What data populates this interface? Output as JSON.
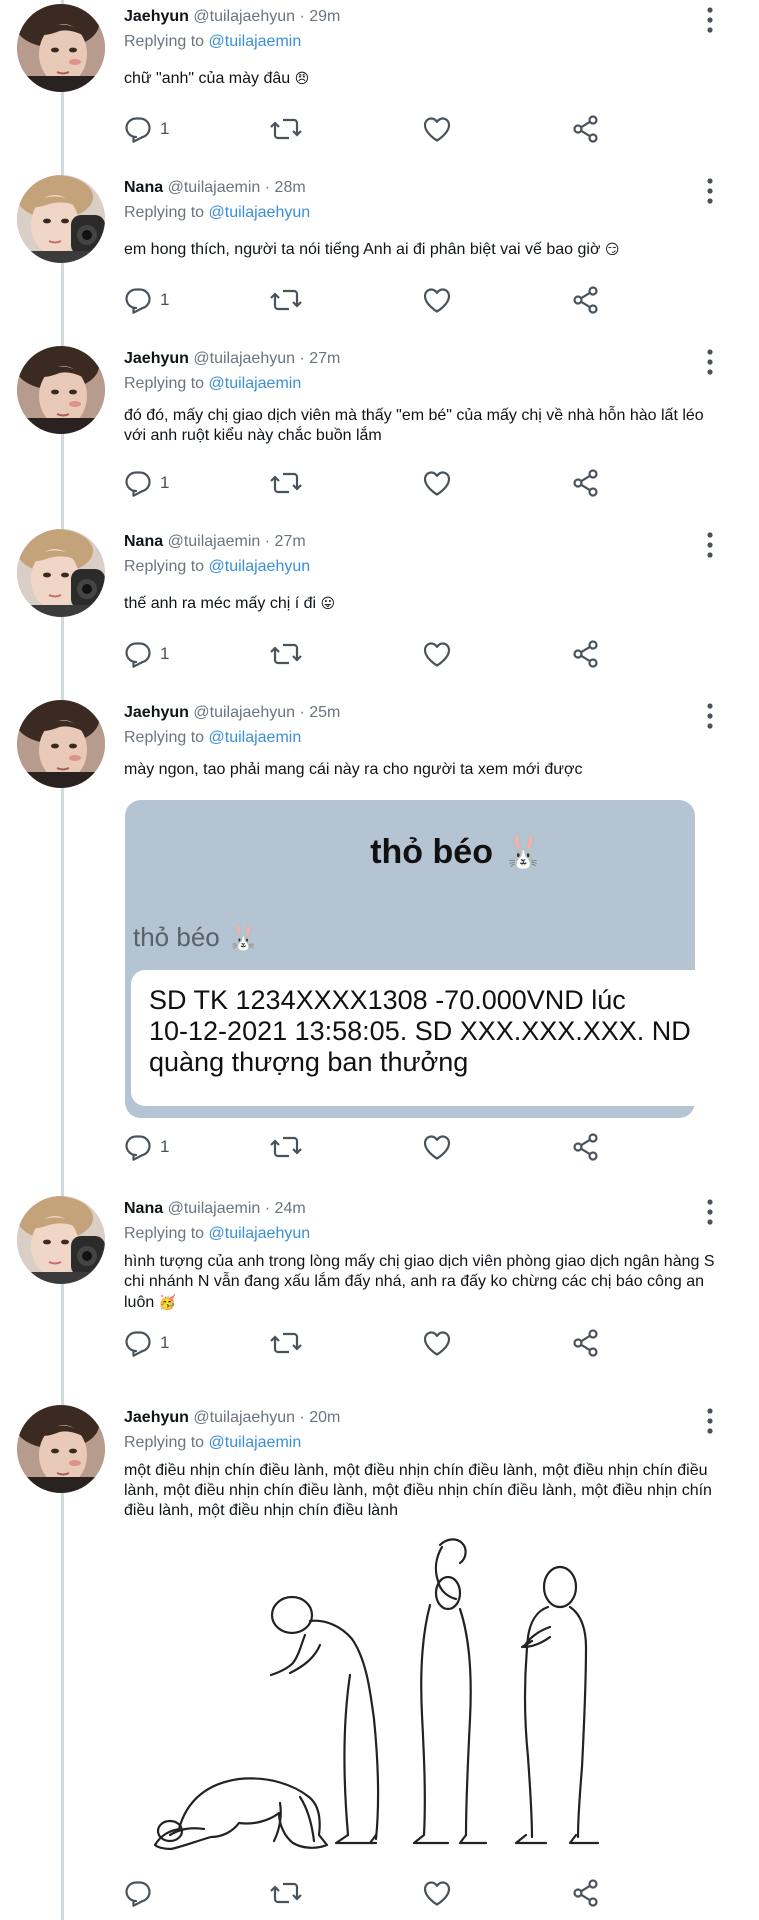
{
  "tweets": [
    {
      "name": "Jaehyun",
      "handle": "@tuilajaehyun",
      "time": "29m",
      "replying_label": "Replying to",
      "replying_to": "@tuilajaemin",
      "text": "chữ \"anh\" của mày đâu",
      "emoji": "😠",
      "reply_count": "1"
    },
    {
      "name": "Nana",
      "handle": "@tuilajaemin",
      "time": "28m",
      "replying_label": "Replying to",
      "replying_to": "@tuilajaehyun",
      "text": "em hong thích, người ta nói tiếng Anh ai đi phân biệt vai vế bao giờ",
      "emoji": "😏",
      "reply_count": "1"
    },
    {
      "name": "Jaehyun",
      "handle": "@tuilajaehyun",
      "time": "27m",
      "replying_label": "Replying to",
      "replying_to": "@tuilajaemin",
      "text": "đó đó, mấy chị giao dịch viên mà thấy \"em bé\" của mấy chị về nhà hỗn hào lất léo với anh ruột kiểu này chắc buồn lắm",
      "reply_count": "1"
    },
    {
      "name": "Nana",
      "handle": "@tuilajaemin",
      "time": "27m",
      "replying_label": "Replying to",
      "replying_to": "@tuilajaehyun",
      "text": "thế anh ra méc mấy chị í đi",
      "emoji": "😛",
      "reply_count": "1"
    },
    {
      "name": "Jaehyun",
      "handle": "@tuilajaehyun",
      "time": "25m",
      "replying_label": "Replying to",
      "replying_to": "@tuilajaemin",
      "text": "mày ngon, tao phải mang cái này ra cho người ta xem mới được",
      "reply_count": "1",
      "card": {
        "title": "thỏ béo 🐰",
        "sender": "thỏ béo 🐰",
        "message": "SD TK 1234XXXX1308 -70.000VND lúc\n10-12-2021 13:58:05. SD XXX.XXX.XXX. ND\nquàng thượng ban thưởng"
      }
    },
    {
      "name": "Nana",
      "handle": "@tuilajaemin",
      "time": "24m",
      "replying_label": "Replying to",
      "replying_to": "@tuilajaehyun",
      "text": "hình tượng của anh trong lòng mấy chị giao dịch viên phòng giao dịch ngân hàng S chi nhánh N vẫn đang xấu lắm đấy nhá, anh ra đấy ko chừng các chị báo công an luôn",
      "emoji": "🥳",
      "reply_count": "1"
    },
    {
      "name": "Jaehyun",
      "handle": "@tuilajaehyun",
      "time": "20m",
      "replying_label": "Replying to",
      "replying_to": "@tuilajaemin",
      "text": "một điều nhịn chín điều lành, một điều nhịn chín điều lành, một điều nhịn chín điều lành, một điều nhịn chín điều lành, một điều nhịn chín điều lành, một điều nhịn chín điều lành, một điều nhịn chín điều lành",
      "reply_count": ""
    }
  ],
  "colors": {
    "link": "#3b8fd6",
    "muted": "#6b7580",
    "thread_line": "#cfd9de",
    "card_bg": "#b5c4d2"
  },
  "icons": [
    "reply-icon",
    "retweet-icon",
    "like-icon",
    "share-icon",
    "more-icon"
  ]
}
